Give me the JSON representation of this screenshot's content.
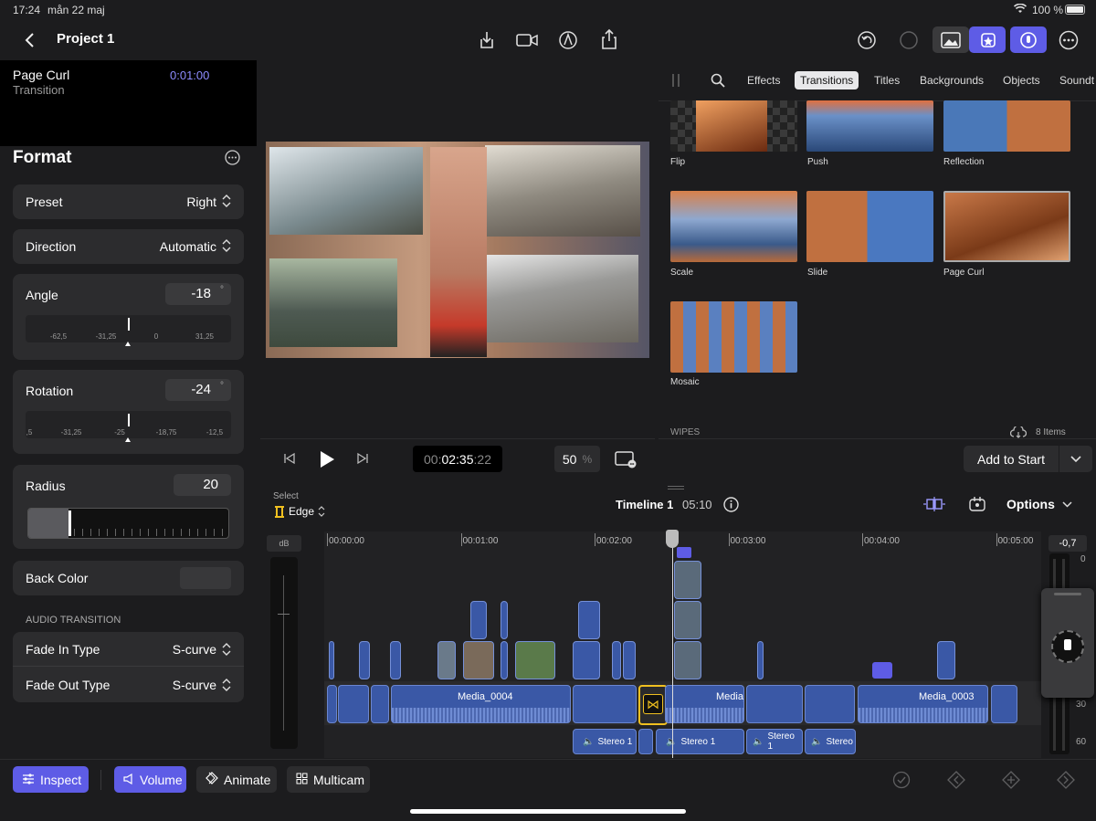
{
  "status": {
    "time": "17:24",
    "date": "mån 22 maj",
    "battery": "100 %"
  },
  "header": {
    "title": "Project 1"
  },
  "inspector": {
    "transition_name": "Page Curl",
    "transition_type": "Transition",
    "duration": "0:01:00",
    "format_title": "Format",
    "preset_label": "Preset",
    "preset_value": "Right",
    "direction_label": "Direction",
    "direction_value": "Automatic",
    "angle_label": "Angle",
    "angle_value": "-18",
    "angle_unit": "°",
    "angle_ticks": [
      "-62,5",
      "-31,25",
      "0",
      "31,25"
    ],
    "rotation_label": "Rotation",
    "rotation_value": "-24",
    "rotation_unit": "°",
    "rotation_ticks": [
      ",5",
      "-31,25",
      "-25",
      "-18,75",
      "-12,5"
    ],
    "radius_label": "Radius",
    "radius_value": "20",
    "back_color_label": "Back Color",
    "audio_section": "AUDIO TRANSITION",
    "fade_in_label": "Fade In Type",
    "fade_in_value": "S-curve",
    "fade_out_label": "Fade Out Type",
    "fade_out_value": "S-curve"
  },
  "viewer": {
    "timecode_prefix": "00:",
    "timecode_main": "02:35",
    "timecode_frames": ":22",
    "zoom": "50",
    "zoom_unit": "%"
  },
  "browser": {
    "tabs": [
      "Effects",
      "Transitions",
      "Titles",
      "Backgrounds",
      "Objects",
      "Soundt"
    ],
    "items": [
      "Flip",
      "Push",
      "Reflection",
      "Scale",
      "Slide",
      "Page Curl",
      "Mosaic"
    ],
    "section": "WIPES",
    "count": "8 Items",
    "add_button": "Add to Start"
  },
  "timeline": {
    "select_label": "Select",
    "edge_label": "Edge",
    "name": "Timeline 1",
    "duration": "05:10",
    "options": "Options",
    "db_label": "dB",
    "meter_value": "-0,7",
    "meter_marks": [
      "0",
      "30",
      "60"
    ],
    "ruler": [
      "00:00:00",
      "00:01:00",
      "00:02:00",
      "00:03:00",
      "00:04:00",
      "00:05:00"
    ],
    "clips": [
      "Media_0004",
      "Media_",
      "Media_0003"
    ],
    "audio_clips": [
      "Stereo 1",
      "Stereo 1",
      "Stereo 1",
      "Stereo"
    ]
  },
  "bottom": {
    "inspect": "Inspect",
    "volume": "Volume",
    "animate": "Animate",
    "multicam": "Multicam"
  }
}
